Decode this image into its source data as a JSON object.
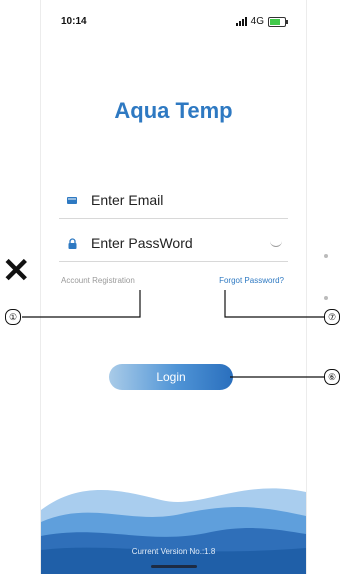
{
  "status_bar": {
    "time": "10:14",
    "network": "4G"
  },
  "app": {
    "title": "Aqua Temp"
  },
  "form": {
    "email_placeholder": "Enter Email",
    "password_placeholder": "Enter PassWord"
  },
  "links": {
    "account_registration": "Account Registration",
    "forgot_password": "Forgot Password?"
  },
  "login_button": {
    "label": "Login"
  },
  "footer": {
    "version": "Current Version No.:1.8"
  },
  "callouts": {
    "one": "①",
    "seven": "⑦",
    "six": "⑥"
  },
  "colors": {
    "accent": "#2e79c2",
    "wave_dark": "#1f5fa8",
    "wave_light": "#7fb6e6"
  }
}
